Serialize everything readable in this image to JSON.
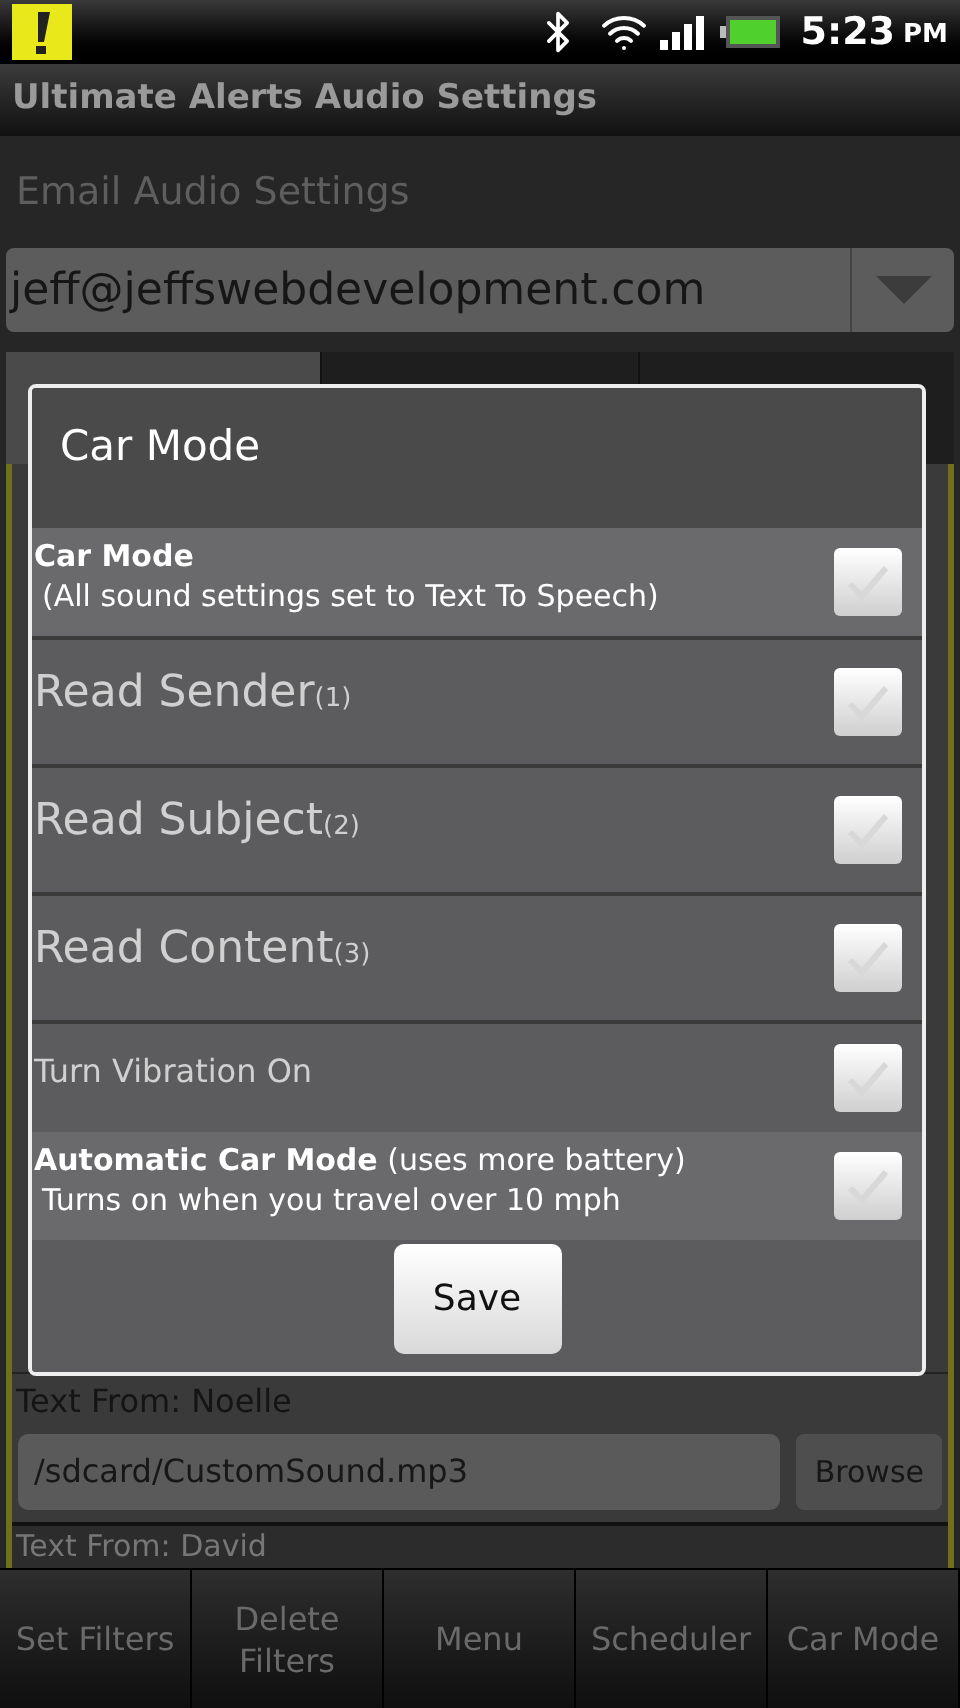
{
  "status_bar": {
    "time": "5:23",
    "ampm": "PM"
  },
  "app_title": "Ultimate Alerts Audio Settings",
  "section_title": "Email Audio Settings",
  "account_spinner": {
    "value": "jeff@jeffswebdevelopment.com"
  },
  "filter_list": {
    "items": [
      {
        "label": "Text From: Noelle",
        "value": "/sdcard/CustomSound.mp3",
        "button": "Browse"
      }
    ],
    "last_label": "Text From: David"
  },
  "dialog": {
    "title": "Car Mode",
    "options": [
      {
        "kind": "titled",
        "title": "Car Mode",
        "summary": "(All sound settings set to Text To Speech)",
        "checked": false
      },
      {
        "kind": "large",
        "label": "Read Sender",
        "note": "(1)",
        "checked": false
      },
      {
        "kind": "large",
        "label": "Read Subject",
        "note": "(2)",
        "checked": false
      },
      {
        "kind": "large",
        "label": "Read Content",
        "note": "(3)",
        "checked": false
      },
      {
        "kind": "plain",
        "label": "Turn Vibration On",
        "checked": false
      },
      {
        "kind": "titled",
        "title": "**Automatic Car Mode** (uses more battery)",
        "summary": "Turns on when you travel over 10 mph",
        "checked": false
      }
    ],
    "button": "Save"
  },
  "bottom_bar": [
    "Set Filters",
    "Delete Filters",
    "Menu",
    "Scheduler",
    "Car Mode"
  ]
}
